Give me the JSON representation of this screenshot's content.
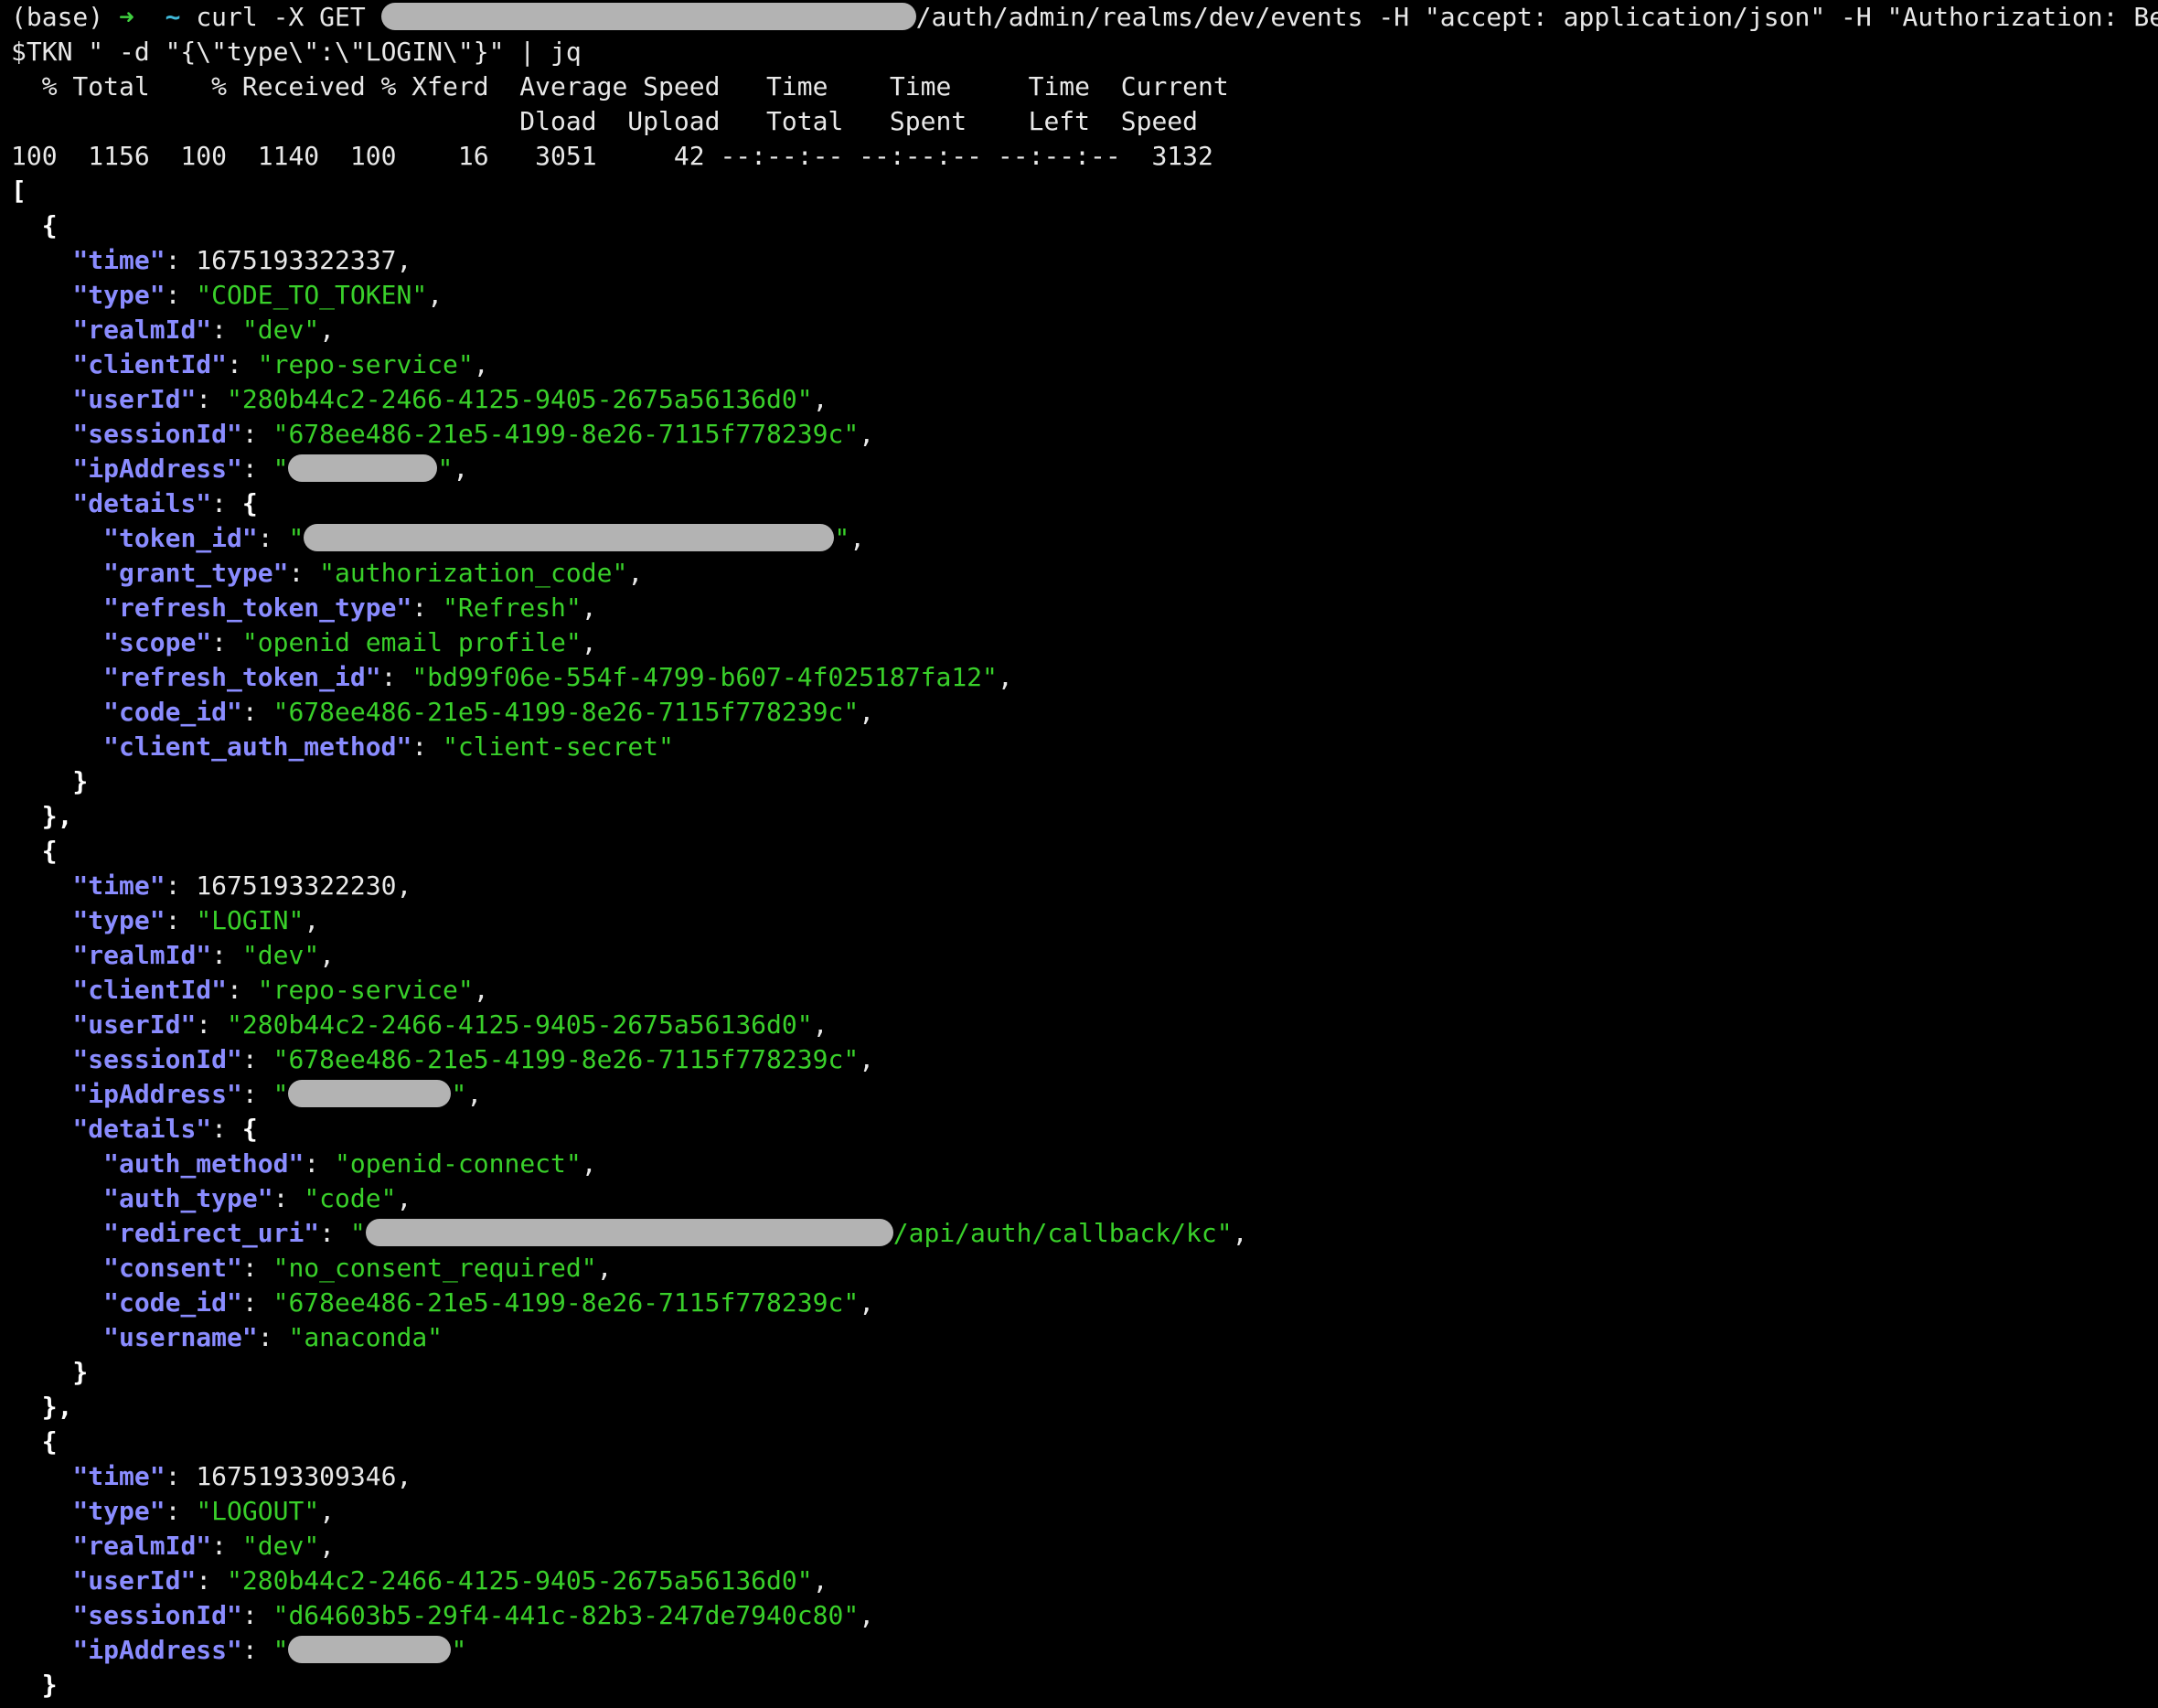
{
  "terminal": {
    "prompt": {
      "env": "(base)",
      "arrow": "➜",
      "dir": "~"
    },
    "command": {
      "part1": "curl -X GET ",
      "part2": "/auth/admin/realms/dev/events -H \"accept: application/json\" -H \"Authorization: Bearer",
      "line2": "$TKN \" -d \"{\\\"type\\\":\\\"LOGIN\\\"}\" | jq"
    },
    "progress": {
      "header1": "  % Total    % Received % Xferd  Average Speed   Time    Time     Time  Current",
      "header2": "                                 Dload  Upload   Total   Spent    Left  Speed",
      "row": "100  1156  100  1140  100    16   3051     42 --:--:-- --:--:-- --:--:--  3132"
    },
    "json": {
      "events": [
        {
          "time": "1675193322337",
          "type": "CODE_TO_TOKEN",
          "realmId": "dev",
          "clientId": "repo-service",
          "userId": "280b44c2-2466-4125-9405-2675a56136d0",
          "sessionId": "678ee486-21e5-4199-8e26-7115f778239c",
          "details": {
            "grant_type": "authorization_code",
            "refresh_token_type": "Refresh",
            "scope": "openid email profile",
            "refresh_token_id": "bd99f06e-554f-4799-b607-4f025187fa12",
            "code_id": "678ee486-21e5-4199-8e26-7115f778239c",
            "client_auth_method": "client-secret"
          }
        },
        {
          "time": "1675193322230",
          "type": "LOGIN",
          "realmId": "dev",
          "clientId": "repo-service",
          "userId": "280b44c2-2466-4125-9405-2675a56136d0",
          "sessionId": "678ee486-21e5-4199-8e26-7115f778239c",
          "details": {
            "auth_method": "openid-connect",
            "auth_type": "code",
            "redirect_uri_suffix": "/api/auth/callback/kc",
            "consent": "no_consent_required",
            "code_id": "678ee486-21e5-4199-8e26-7115f778239c",
            "username": "anaconda"
          }
        },
        {
          "time": "1675193309346",
          "type": "LOGOUT",
          "realmId": "dev",
          "userId": "280b44c2-2466-4125-9405-2675a56136d0",
          "sessionId": "d64603b5-29f4-441c-82b3-247de7940c80"
        }
      ]
    },
    "colors": {
      "background": "#000000",
      "key": "#8a8cff",
      "string": "#39d02a",
      "prompt_arrow": "#3fcf3f",
      "prompt_dir": "#3fb8d8",
      "redaction": "#b3b3b3"
    }
  }
}
